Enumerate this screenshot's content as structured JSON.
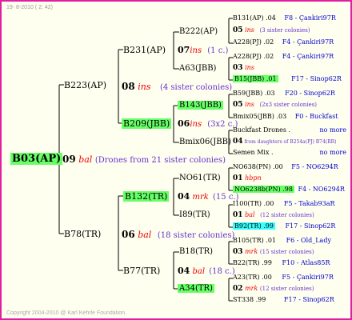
{
  "header": "19-  8-2010 (  2: 42)",
  "footer": "Copyright 2004-2010 @ Karl Kehrle Foundation.",
  "root": {
    "name": "B03(AP)",
    "year": "09",
    "race": "bal",
    "note": "(Drones from 21 sister colonies)"
  },
  "g1": {
    "top": {
      "name": "B223(AP)",
      "year": "08",
      "race": "ins",
      "note": "(4 sister colonies)"
    },
    "bottom": {
      "name": "B78(TR)",
      "year": "06",
      "race": "bal",
      "note": "(18 sister colonies)"
    }
  },
  "g2": {
    "b231": {
      "name": "B231(AP)",
      "year": "07",
      "race": "ins",
      "note": "(1 c.)"
    },
    "b209": {
      "name": "B209(JBB)",
      "year": "06",
      "race": "ins",
      "note": "(3x2 c.)"
    },
    "b132": {
      "name": "B132(TR)",
      "year": "04",
      "race": "mrk",
      "note": "(15 c.)"
    },
    "b77": {
      "name": "B77(TR)",
      "year": "04",
      "race": "bal",
      "note": "(18 c.)"
    }
  },
  "g3": {
    "b222": "B222(AP)",
    "a63": "A63(JBB)",
    "b143": "B143(JBB)",
    "bmix06": "Bmix06(JBB)",
    "no61": "NO61(TR)",
    "i89": "I89(TR)",
    "b18": "B18(TR)",
    "a34": "A34(TR)"
  },
  "right": {
    "r1": {
      "name": "B131(AP)",
      "yr": ".04",
      "info": "F8 - Çankiri97R"
    },
    "r2": {
      "yr": "05",
      "race": "ins",
      "note": "(3 sister colonies)"
    },
    "r3": {
      "name": "A228(PJ)",
      "yr": ".02",
      "info": "F4 - Çankiri97R"
    },
    "r4": {
      "name": "A228(PJ)",
      "yr": ".02",
      "info": "F4 - Çankiri97R"
    },
    "r5": {
      "yr": "03",
      "race": "ins"
    },
    "r6": {
      "name": "B15(JBB)",
      "yr": ".01",
      "info": "F17 - Sinop62R"
    },
    "r7": {
      "name": "B59(JBB)",
      "yr": ".03",
      "info": "F20 - Sinop62R"
    },
    "r8": {
      "yr": "05",
      "race": "ins",
      "note": "(2x3 sister colonies)"
    },
    "r9": {
      "name": "Bmix05(JBB)",
      "yr": ".03",
      "info": "F0 - Buckfast"
    },
    "r10": {
      "name": "Buckfast Drones .",
      "info": "no more"
    },
    "r11": {
      "yr": "04",
      "note": "from daughters of B254a(PJ) B74(RR)"
    },
    "r12": {
      "name": "Semen Mix .",
      "info": "no more"
    },
    "r13": {
      "name": "NO638(PN)",
      "yr": ".00",
      "info": "F5 - NO6294R"
    },
    "r14": {
      "yr": "01",
      "race": "hbpn"
    },
    "r15": {
      "name": "NO6238b(PN)",
      "yr": ".98",
      "info": "F4 - NO6294R"
    },
    "r16": {
      "name": "I100(TR)",
      "yr": ".00",
      "info": "F5 - Takab93aR"
    },
    "r17": {
      "yr": "01",
      "race": "bal",
      "note": "(12 sister colonies)"
    },
    "r18": {
      "name": "B92(TR)",
      "yr": ".99",
      "info": "F17 - Sinop62R"
    },
    "r19": {
      "name": "B105(TR)",
      "yr": ".01",
      "info": "F6 - Old_Lady"
    },
    "r20": {
      "yr": "03",
      "race": "mrk",
      "note": "(15 sister colonies)"
    },
    "r21": {
      "name": "B22(TR)",
      "yr": ".99",
      "info": "F10 - Atlas85R"
    },
    "r22": {
      "name": "A23(TR)",
      "yr": ".00",
      "info": "F5 - Çankiri97R"
    },
    "r23": {
      "yr": "02",
      "race": "mrk",
      "note": "(12 sister colonies)"
    },
    "r24": {
      "name": "ST338",
      "yr": ".99",
      "info": "F17 - Sinop62R"
    }
  },
  "colors": {
    "border": "#e020a0",
    "highlight_green": "#66ff66",
    "highlight_cyan": "#33ffff",
    "race": "#ee0000",
    "note": "#6633cc",
    "info": "#0000cc"
  }
}
